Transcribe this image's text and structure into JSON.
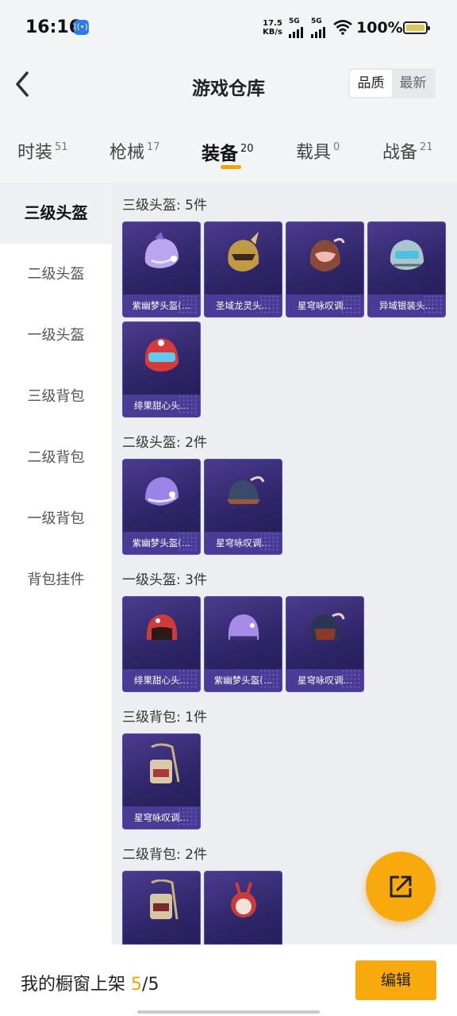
{
  "status": {
    "time": "16:16",
    "hotspot_icon": "hotspot-icon",
    "speed_value": "17.5",
    "speed_unit": "KB/s",
    "sim1_label": "5G",
    "sim2_label": "5G",
    "battery_pct": "100%"
  },
  "header": {
    "title": "游戏仓库",
    "sort_options": [
      "品质",
      "最新"
    ]
  },
  "tabs": [
    {
      "label": "时装",
      "count": "51"
    },
    {
      "label": "枪械",
      "count": "17"
    },
    {
      "label": "装备",
      "count": "20"
    },
    {
      "label": "载具",
      "count": "0"
    },
    {
      "label": "战备",
      "count": "21"
    }
  ],
  "sidebar": {
    "items": [
      "三级头盔",
      "二级头盔",
      "一级头盔",
      "三级背包",
      "二级背包",
      "一级背包",
      "背包挂件"
    ]
  },
  "sections": [
    {
      "title": "三级头盔: 5件",
      "items": [
        "紫幽梦头盔(…",
        "圣域龙灵头…",
        "星穹咏叹调…",
        "异域银装头…",
        "绯果甜心头…"
      ]
    },
    {
      "title": "二级头盔: 2件",
      "items": [
        "紫幽梦头盔(…",
        "星穹咏叹调…"
      ]
    },
    {
      "title": "一级头盔: 3件",
      "items": [
        "绯果甜心头…",
        "紫幽梦头盔(…",
        "星穹咏叹调…"
      ]
    },
    {
      "title": "三级背包: 1件",
      "items": [
        "星穹咏叹调…"
      ]
    },
    {
      "title": "二级背包: 2件",
      "items": [
        "",
        ""
      ]
    }
  ],
  "bottom": {
    "shelf_label": "我的橱窗上架",
    "shelf_current": "5",
    "shelf_sep": "/",
    "shelf_total": "5",
    "edit_label": "编辑"
  },
  "colors": {
    "accent": "#f8a90d",
    "card_bg": "#2d2466"
  }
}
